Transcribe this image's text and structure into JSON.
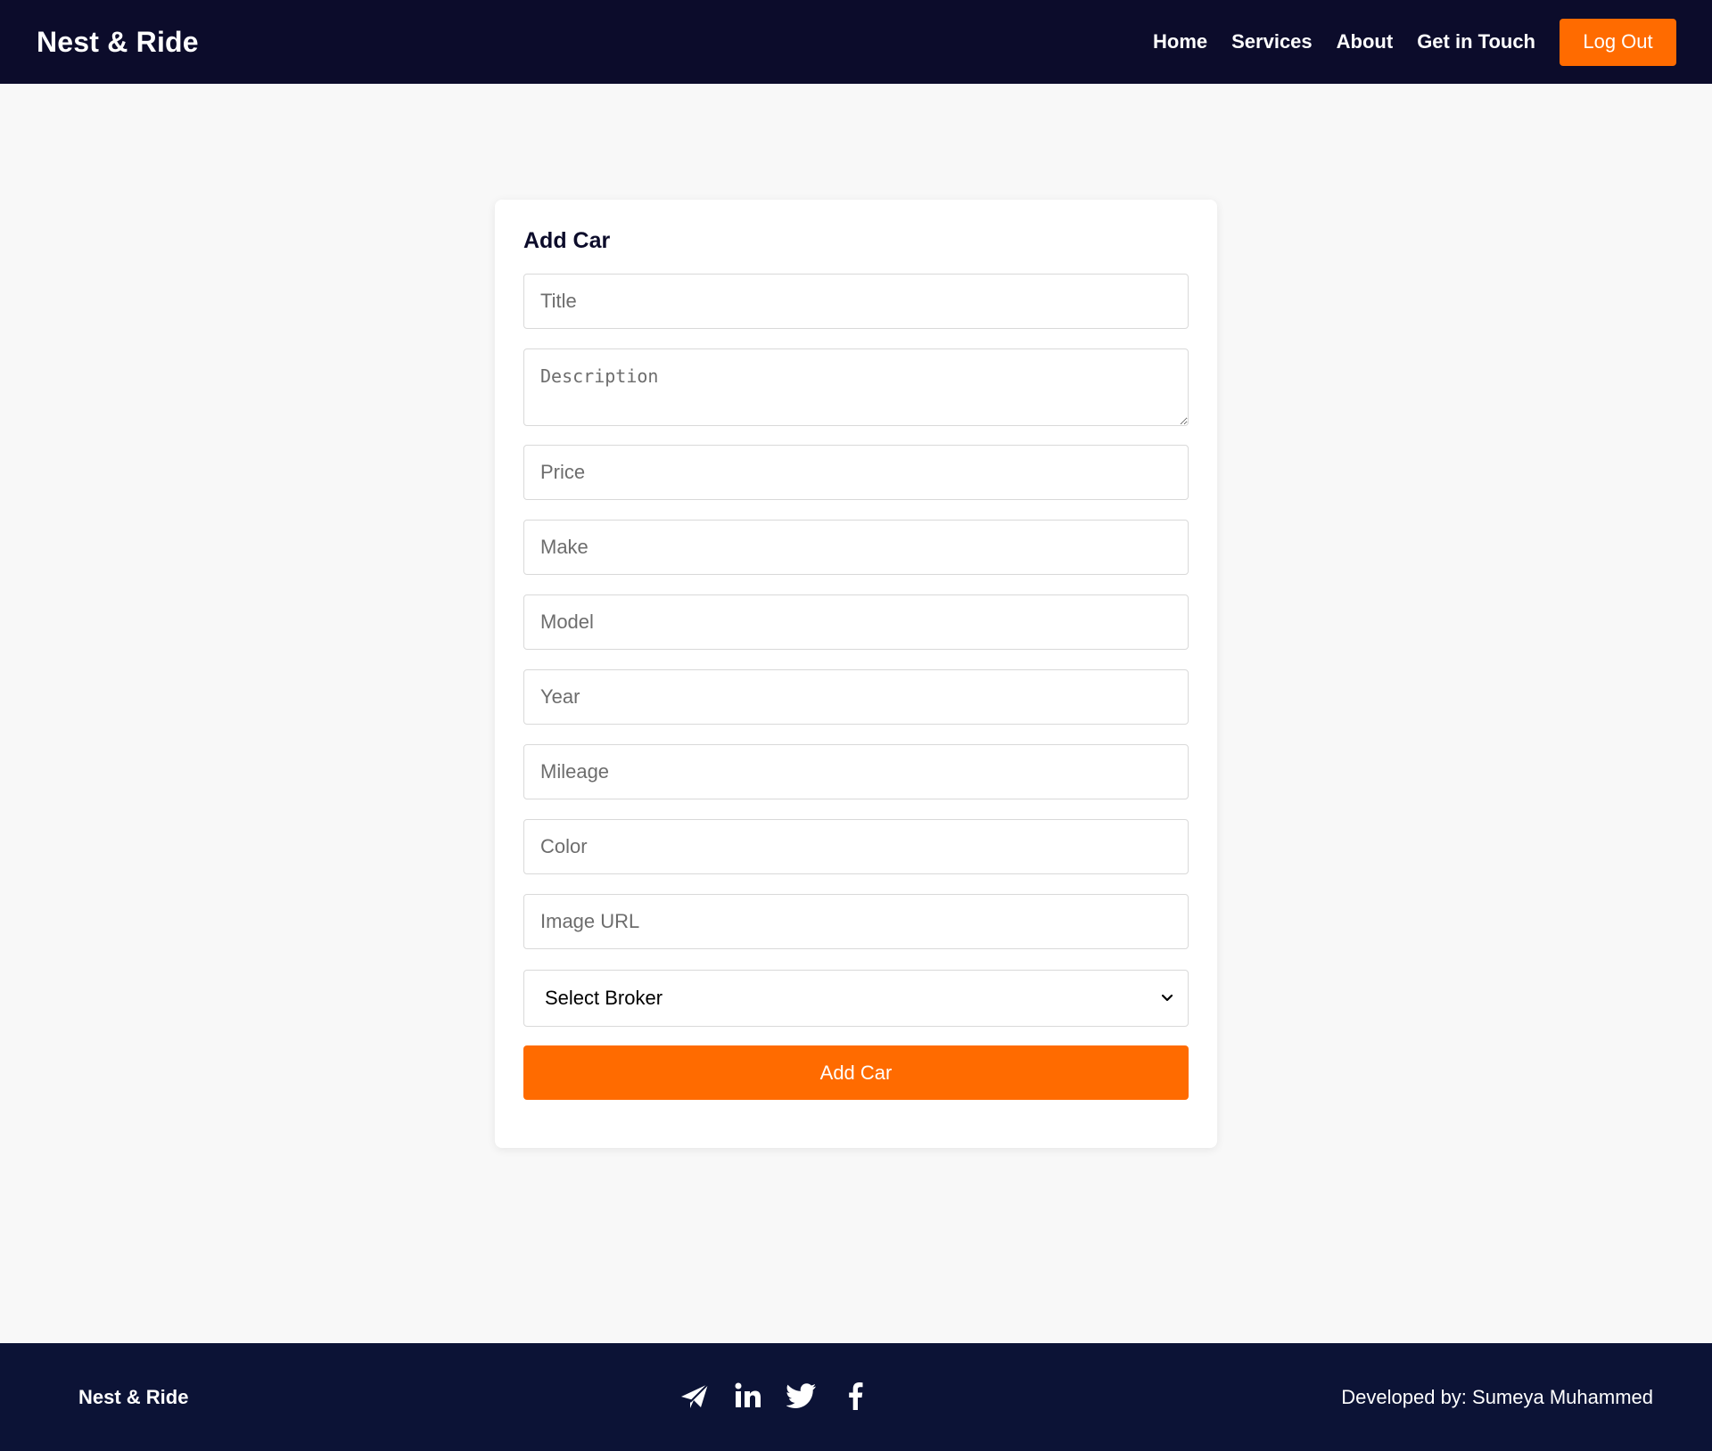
{
  "header": {
    "brand": "Nest & Ride",
    "nav": [
      "Home",
      "Services",
      "About",
      "Get in Touch"
    ],
    "logout_label": "Log Out"
  },
  "form": {
    "title": "Add Car",
    "placeholders": {
      "title": "Title",
      "description": "Description",
      "price": "Price",
      "make": "Make",
      "model": "Model",
      "year": "Year",
      "mileage": "Mileage",
      "color": "Color",
      "image_url": "Image URL"
    },
    "broker_select": "Select Broker",
    "submit_label": "Add Car"
  },
  "footer": {
    "brand": "Nest & Ride",
    "social_icons": [
      "telegram-icon",
      "linkedin-icon",
      "twitter-icon",
      "facebook-icon"
    ],
    "credit": "Developed by: Sumeya Muhammed"
  },
  "colors": {
    "header_bg": "#0c0c2b",
    "footer_bg": "#0c1336",
    "accent": "#ff6b00",
    "page_bg": "#f8f8f8"
  }
}
